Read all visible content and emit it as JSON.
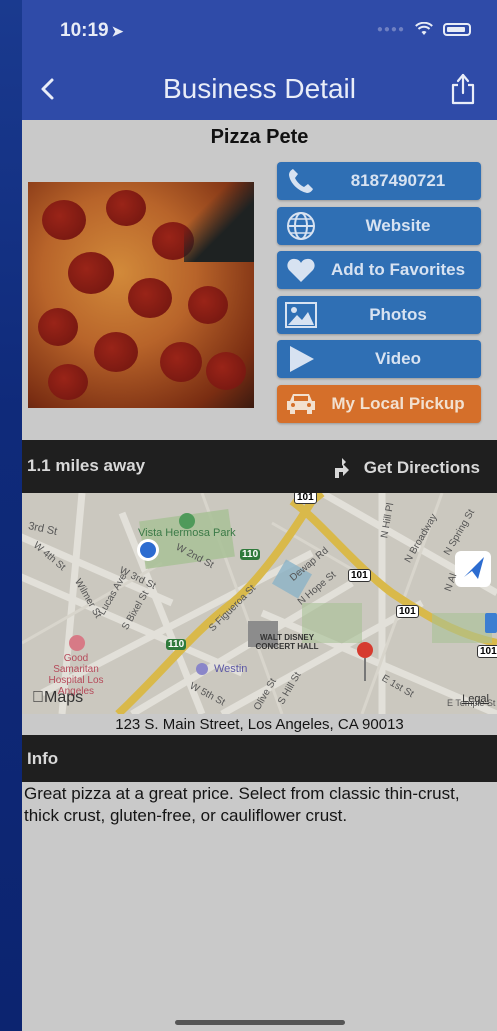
{
  "status_bar": {
    "time": "10:19",
    "location_glyph": "➤"
  },
  "nav": {
    "title": "Business Detail"
  },
  "business": {
    "name": "Pizza Pete",
    "distance": "1.1 miles away",
    "directions_label": "Get Directions",
    "address": "123 S. Main Street, Los  Angeles, CA 90013",
    "info_label": "Info",
    "description": "Great pizza at a great price.  Select from classic thin-crust, thick crust, gluten-free, or cauliflower crust."
  },
  "actions": [
    {
      "label": "8187490721",
      "icon": "phone-icon"
    },
    {
      "label": "Website",
      "icon": "globe-icon"
    },
    {
      "label": "Add to Favorites",
      "icon": "heart-icon"
    },
    {
      "label": "Photos",
      "icon": "image-icon"
    },
    {
      "label": "Video",
      "icon": "play-icon"
    },
    {
      "label": "My Local Pickup",
      "icon": "car-icon"
    }
  ],
  "map": {
    "logo_text": "Maps",
    "legal_text": "Legal",
    "labels": {
      "park": "Vista Hermosa Park",
      "concert_hall": "WALT DISNEY CONCERT HALL",
      "hospital": "Good Samaritan Hospital Los Angeles",
      "westin": "Westin",
      "st_3rd": "3rd St",
      "w_4th": "W 4th St",
      "w_2nd": "W 2nd St",
      "w_3rd": "W 3rd St",
      "lucas": "Lucas Ave",
      "bixel": "S Bixel St",
      "figueroa": "S Figueroa St",
      "hope": "N Hope St",
      "dewap": "Dewap Rd",
      "hill": "N Hill Pl",
      "broadway": "N Broadway",
      "spring": "N Spring St",
      "al": "N Al",
      "w_5th": "W 5th St",
      "olive": "Olive St",
      "s_hill": "S Hill St",
      "e_1st": "E 1st St",
      "temple": "E Temple St",
      "wilmer": "Wilmer St",
      "shield_101a": "101",
      "shield_101b": "101",
      "shield_101c": "101",
      "shield_101d": "101",
      "shield_110a": "110",
      "shield_110b": "110"
    }
  },
  "colors": {
    "nav_bg": "#2f4ba8",
    "action_blue": "#2f6fb4",
    "action_orange": "#d56f2a",
    "dark_bar": "#1f1f1f"
  }
}
